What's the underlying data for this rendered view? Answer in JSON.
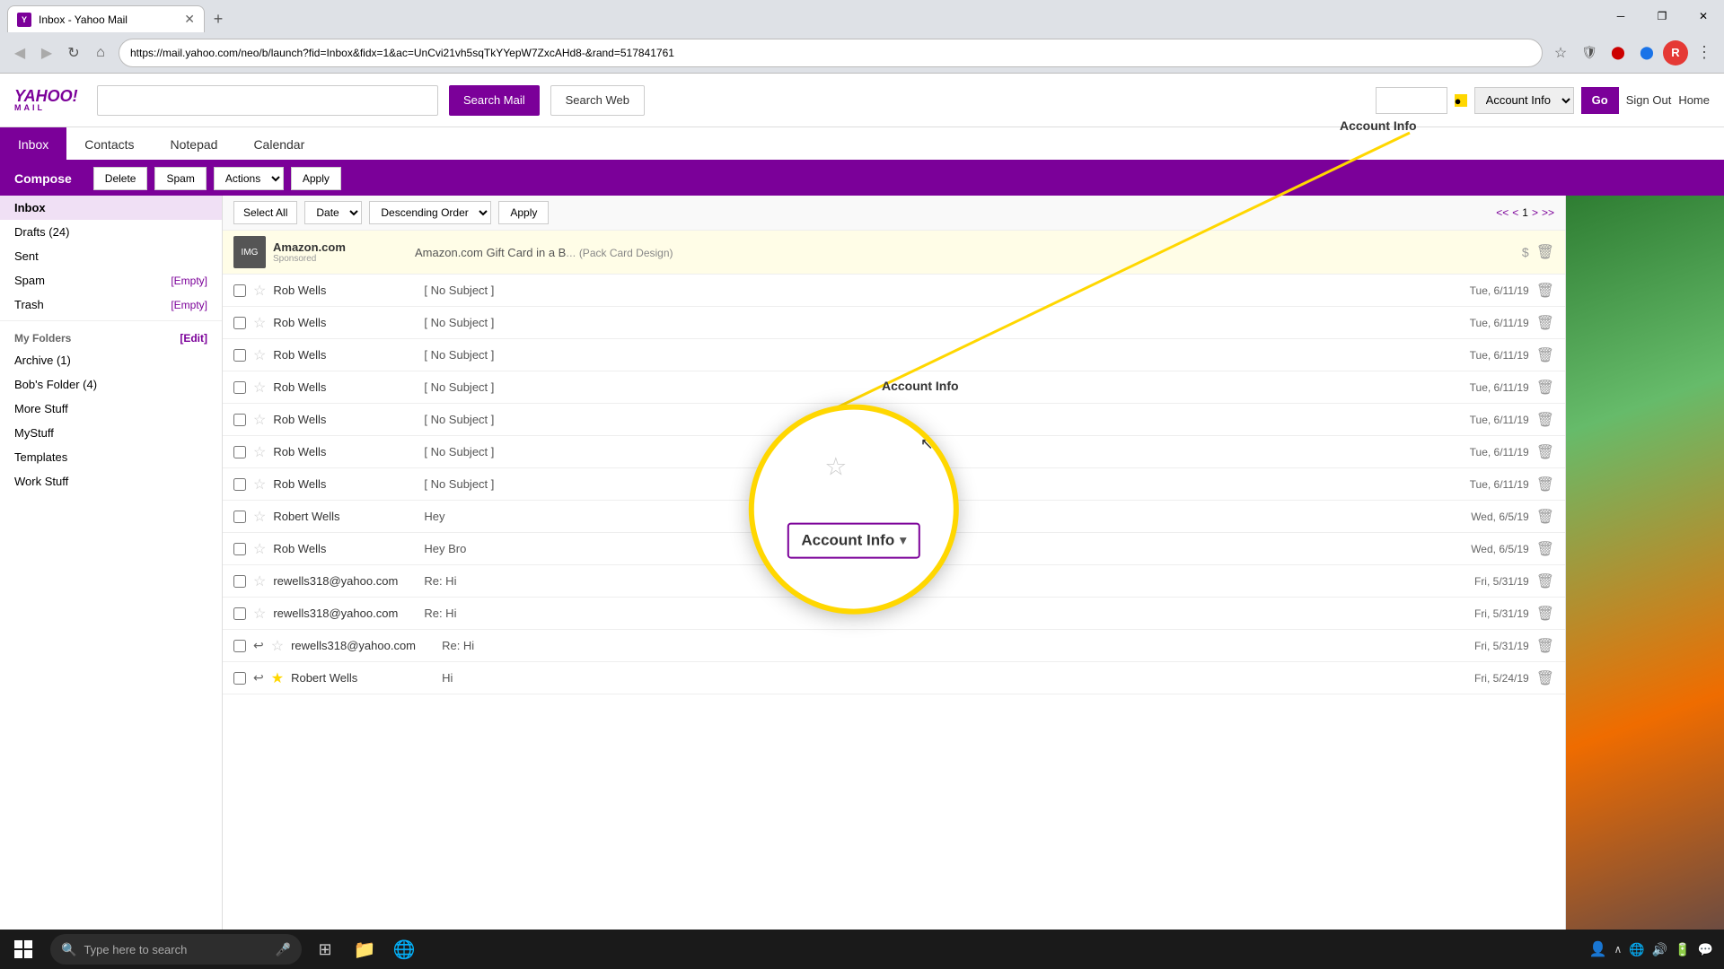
{
  "browser": {
    "tab_title": "Inbox - Yahoo Mail",
    "url": "https://mail.yahoo.com/neo/b/launch?fid=Inbox&fidx=1&ac=UnCvi21vh5sqTkYYepW7ZxcAHd8-&rand=517841761",
    "new_tab_label": "+",
    "nav": {
      "back": "◀",
      "forward": "▶",
      "refresh": "↻",
      "home": "⌂"
    },
    "window_controls": {
      "minimize": "─",
      "maximize": "❐",
      "close": "✕"
    }
  },
  "yahoo": {
    "logo_main": "YAHOO!",
    "logo_sub": "MAIL",
    "search_placeholder": "",
    "search_mail_btn": "Search Mail",
    "search_web_btn": "Search Web",
    "header": {
      "account_info_label": "Account Info",
      "go_btn": "Go",
      "sign_out": "Sign Out",
      "home": "Home"
    }
  },
  "nav_tabs": [
    {
      "label": "Inbox",
      "active": true
    },
    {
      "label": "Contacts",
      "active": false
    },
    {
      "label": "Notepad",
      "active": false
    },
    {
      "label": "Calendar",
      "active": false
    }
  ],
  "toolbar": {
    "compose_label": "Compose",
    "delete_label": "Delete",
    "spam_label": "Spam",
    "actions_label": "Actions",
    "apply_label": "Apply"
  },
  "email_list_controls": {
    "select_all_label": "Select All",
    "date_label": "Date",
    "order_label": "Descending Order",
    "apply_label": "Apply",
    "page_current": "1",
    "page_first": "<<",
    "page_prev": "<",
    "page_next": ">",
    "page_last": ">>"
  },
  "sidebar": {
    "compose_label": "Compose",
    "items": [
      {
        "label": "Inbox",
        "count": "",
        "active": true
      },
      {
        "label": "Drafts",
        "count": "(24)",
        "active": false
      },
      {
        "label": "Sent",
        "count": "",
        "active": false
      },
      {
        "label": "Spam",
        "count": "",
        "active": false,
        "action": "[Empty]"
      },
      {
        "label": "Trash",
        "count": "",
        "active": false,
        "action": "[Empty]"
      }
    ],
    "my_folders_label": "My Folders",
    "my_folders_action": "[Edit]",
    "folders": [
      {
        "label": "Archive (1)"
      },
      {
        "label": "Bob's Folder (4)"
      },
      {
        "label": "More Stuff"
      },
      {
        "label": "MyStuff"
      },
      {
        "label": "Templates"
      },
      {
        "label": "Work Stuff"
      }
    ]
  },
  "emails": [
    {
      "sponsored": true,
      "sender": "Amazon.com",
      "sub_sender": "Sponsored",
      "subject": "Amazon.com Gift Card in a B",
      "subject_full": "Amazon.com Gift Card in a Box (Pack Card Design)",
      "from_domain": "Amazon.com",
      "date": "",
      "has_dollar": true
    },
    {
      "sender": "Rob Wells",
      "subject": "[ No Subject ]",
      "date": "Tue, 6/11/19",
      "starred": false
    },
    {
      "sender": "Rob Wells",
      "subject": "[ No Subject ]",
      "date": "Tue, 6/11/19",
      "starred": false
    },
    {
      "sender": "Rob Wells",
      "subject": "[ No Subject ]",
      "date": "Tue, 6/11/19",
      "starred": false
    },
    {
      "sender": "Rob Wells",
      "subject": "[ No Subject ]",
      "date": "Tue, 6/11/19",
      "starred": false
    },
    {
      "sender": "Rob Wells",
      "subject": "[ No Subject ]",
      "date": "Tue, 6/11/19",
      "starred": false
    },
    {
      "sender": "Rob Wells",
      "subject": "[ No Subject ]",
      "date": "Tue, 6/11/19",
      "starred": false
    },
    {
      "sender": "Rob Wells",
      "subject": "[ No Subject ]",
      "date": "Tue, 6/11/19",
      "starred": false
    },
    {
      "sender": "Robert Wells",
      "subject": "Hey",
      "date": "Wed, 6/5/19",
      "starred": false
    },
    {
      "sender": "Rob Wells",
      "subject": "Hey Bro",
      "date": "Wed, 6/5/19",
      "starred": false
    },
    {
      "sender": "rewells318@yahoo.com",
      "subject": "Re: Hi",
      "date": "Fri, 5/31/19",
      "starred": false
    },
    {
      "sender": "rewells318@yahoo.com",
      "subject": "Re: Hi",
      "date": "Fri, 5/31/19",
      "starred": false
    },
    {
      "sender": "rewells318@yahoo.com",
      "subject": "Re: Hi",
      "date": "Fri, 5/31/19",
      "starred": false,
      "has_reply": true
    },
    {
      "sender": "Robert Wells",
      "subject": "Hi",
      "date": "Fri, 5/24/19",
      "starred": false,
      "has_reply": true
    }
  ],
  "magnifier": {
    "account_info_text": "Account Info",
    "dropdown_arrow": "▾"
  },
  "account_info_callout": {
    "label": "Account Info",
    "label2": "Account Info"
  },
  "taskbar": {
    "search_placeholder": "Type here to search",
    "time": "...",
    "apps": [
      "task-view",
      "file-explorer",
      "chrome",
      "network"
    ]
  }
}
